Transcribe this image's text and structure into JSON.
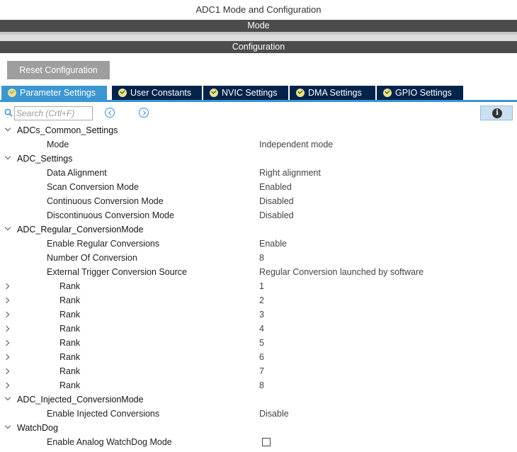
{
  "window": {
    "title": "ADC1 Mode and Configuration"
  },
  "sections": {
    "mode": "Mode",
    "configuration": "Configuration"
  },
  "toolbar": {
    "reset_label": "Reset Configuration"
  },
  "tabs": [
    {
      "label": "Parameter Settings",
      "active": true
    },
    {
      "label": "User Constants",
      "active": false
    },
    {
      "label": "NVIC Settings",
      "active": false
    },
    {
      "label": "DMA Settings",
      "active": false
    },
    {
      "label": "GPIO Settings",
      "active": false
    }
  ],
  "search": {
    "placeholder": "Search (Crtl+F)"
  },
  "icons": {
    "search": "search-icon",
    "prev": "chevron-left-circle-icon",
    "next": "chevron-right-circle-icon",
    "info": "info-icon",
    "check": "check-circle-icon"
  },
  "colors": {
    "active_tab": "#3b96d1",
    "tab": "#03234b",
    "section_bar": "#4c4c4c",
    "check": "#e8e18a"
  },
  "tree": {
    "common": {
      "label": "ADCs_Common_Settings",
      "params": [
        {
          "label": "Mode",
          "value": "Independent mode"
        }
      ]
    },
    "adc": {
      "label": "ADC_Settings",
      "params": [
        {
          "label": "Data Alignment",
          "value": "Right alignment"
        },
        {
          "label": "Scan Conversion Mode",
          "value": "Enabled"
        },
        {
          "label": "Continuous Conversion Mode",
          "value": "Disabled"
        },
        {
          "label": "Discontinuous Conversion Mode",
          "value": "Disabled"
        }
      ]
    },
    "regular": {
      "label": "ADC_Regular_ConversionMode",
      "params": [
        {
          "label": "Enable Regular Conversions",
          "value": "Enable"
        },
        {
          "label": "Number Of Conversion",
          "value": "8"
        },
        {
          "label": "External Trigger Conversion Source",
          "value": "Regular Conversion launched by software"
        }
      ],
      "ranks": [
        {
          "label": "Rank",
          "value": "1"
        },
        {
          "label": "Rank",
          "value": "2"
        },
        {
          "label": "Rank",
          "value": "3"
        },
        {
          "label": "Rank",
          "value": "4"
        },
        {
          "label": "Rank",
          "value": "5"
        },
        {
          "label": "Rank",
          "value": "6"
        },
        {
          "label": "Rank",
          "value": "7"
        },
        {
          "label": "Rank",
          "value": "8"
        }
      ]
    },
    "injected": {
      "label": "ADC_Injected_ConversionMode",
      "params": [
        {
          "label": "Enable Injected Conversions",
          "value": "Disable"
        }
      ]
    },
    "watchdog": {
      "label": "WatchDog",
      "params": [
        {
          "label": "Enable Analog WatchDog Mode",
          "checked": false
        }
      ]
    }
  }
}
